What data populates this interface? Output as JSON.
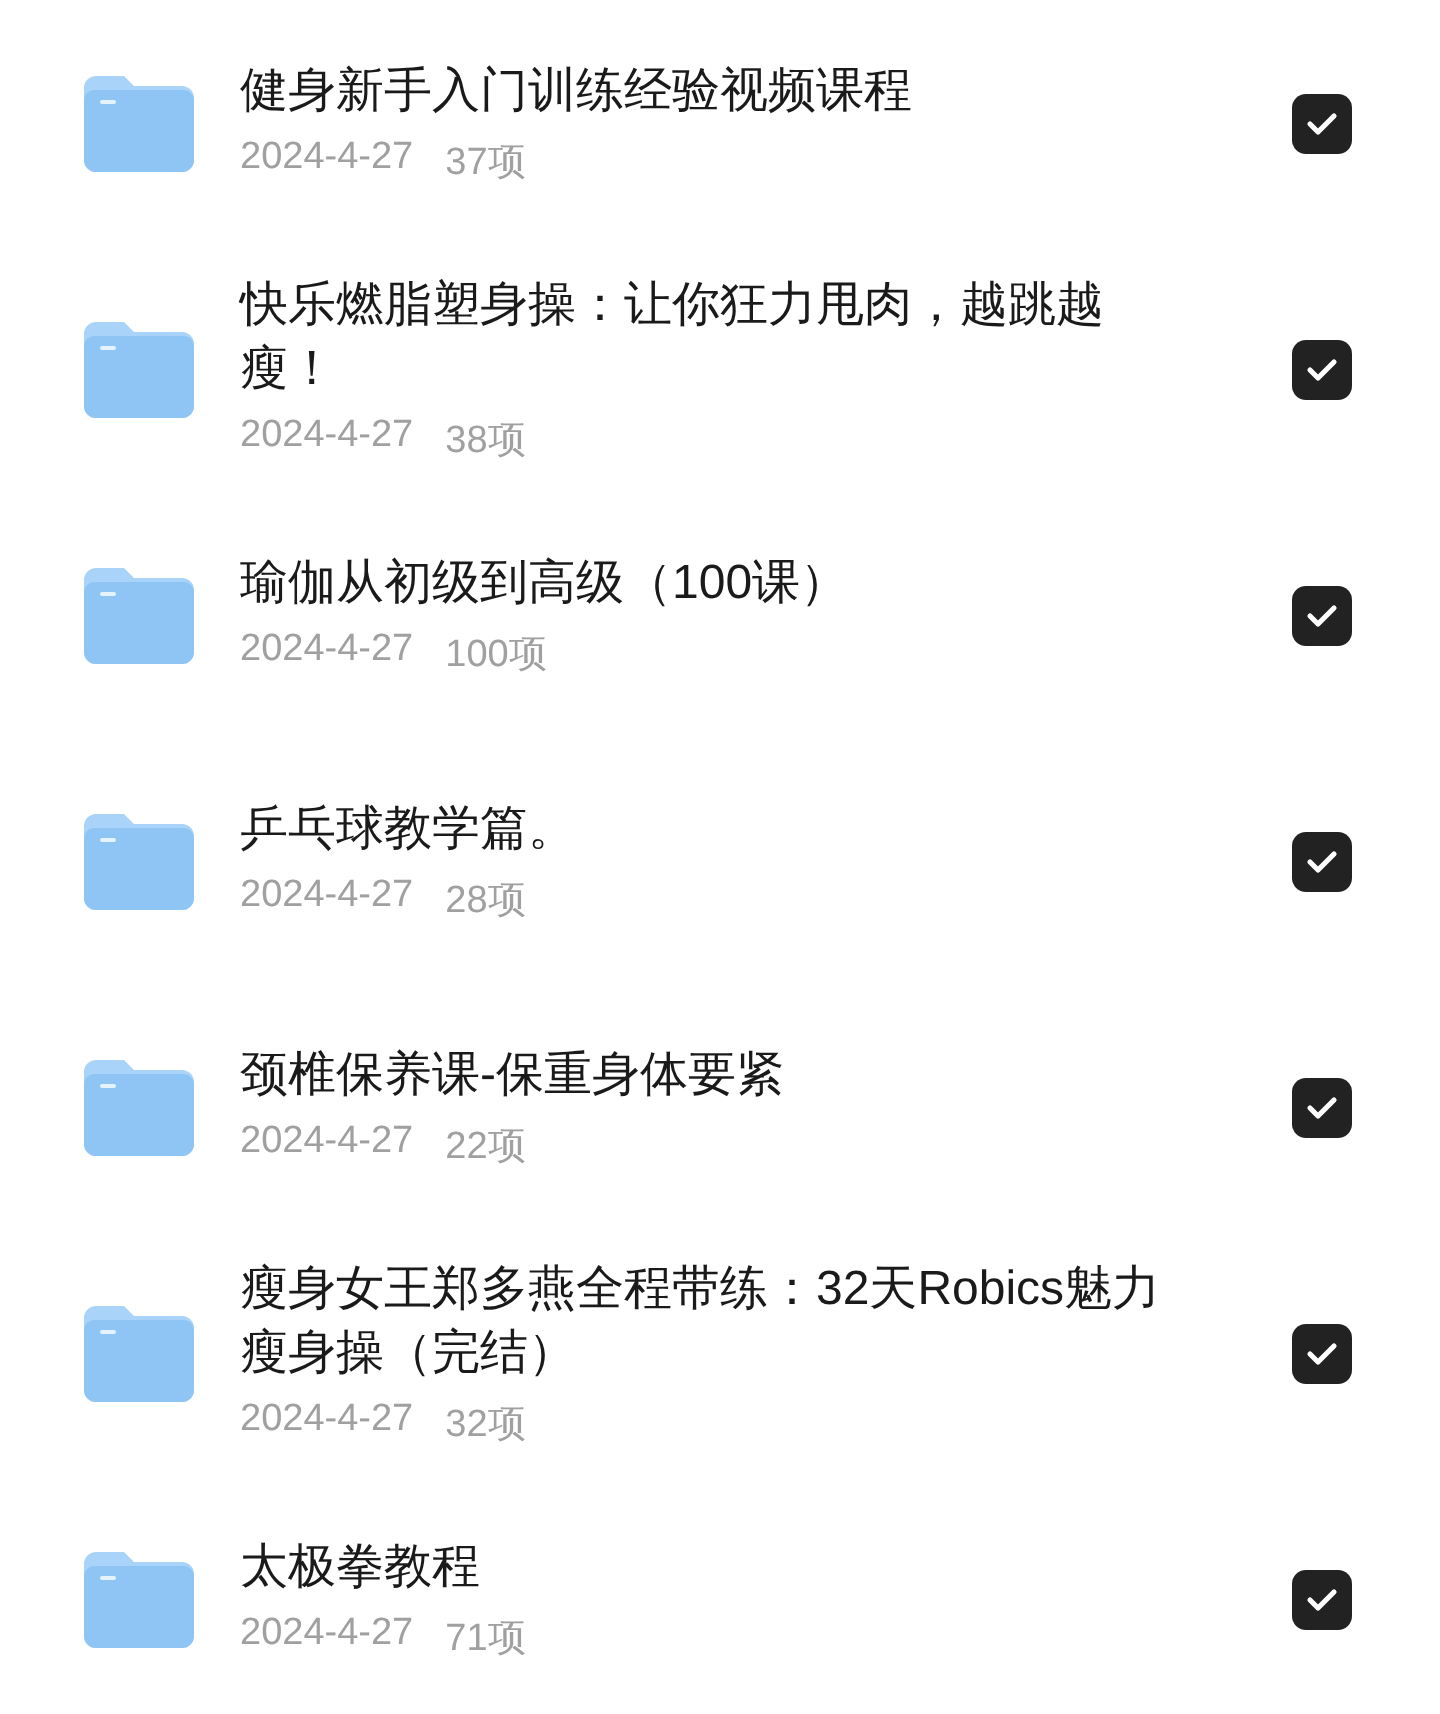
{
  "items": [
    {
      "title": "健身新手入门训练经验视频课程",
      "date": "2024-4-27",
      "count": "37项",
      "checked": true
    },
    {
      "title": "快乐燃脂塑身操：让你狂力甩肉，越跳越瘦！",
      "date": "2024-4-27",
      "count": "38项",
      "checked": true
    },
    {
      "title": "瑜伽从初级到高级（100课）",
      "date": "2024-4-27",
      "count": "100项",
      "checked": true
    },
    {
      "title": "乒乓球教学篇。",
      "date": "2024-4-27",
      "count": "28项",
      "checked": true
    },
    {
      "title": "颈椎保养课-保重身体要紧",
      "date": "2024-4-27",
      "count": "22项",
      "checked": true
    },
    {
      "title": "瘦身女王郑多燕全程带练：32天Robics魅力瘦身操（完结）",
      "date": "2024-4-27",
      "count": "32项",
      "checked": true
    },
    {
      "title": "太极拳教程",
      "date": "2024-4-27",
      "count": "71项",
      "checked": true
    }
  ]
}
